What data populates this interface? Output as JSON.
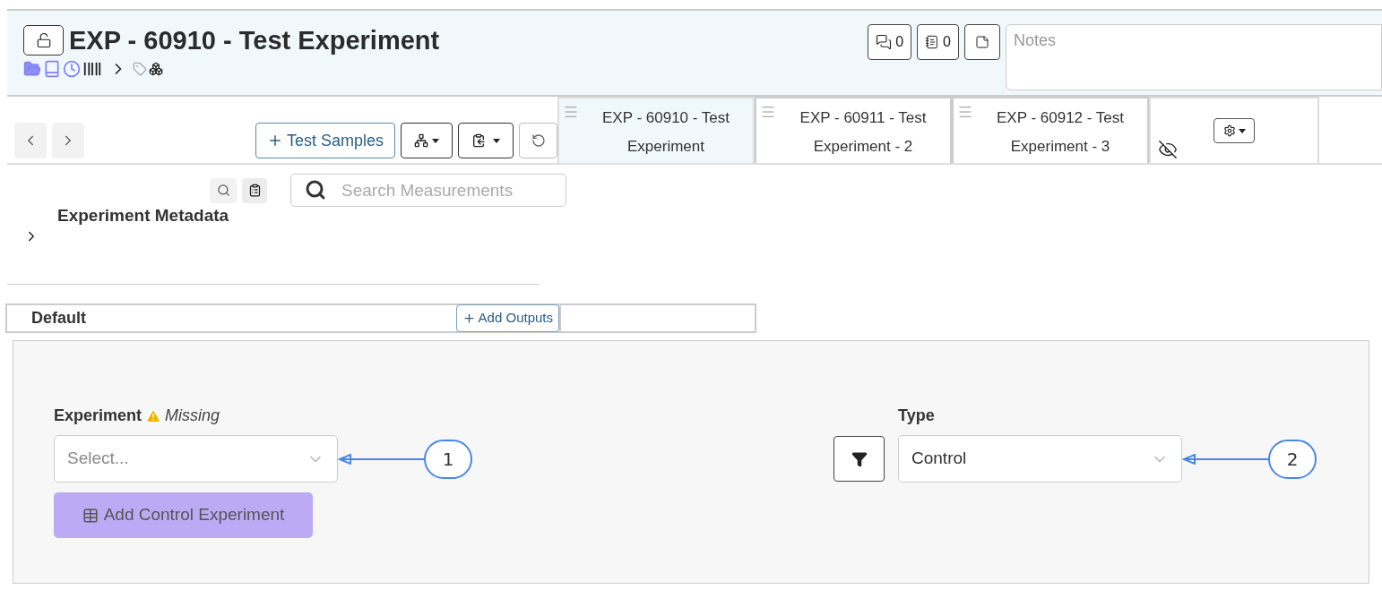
{
  "header": {
    "title": "EXP - 60910 - Test Experiment",
    "locked": false,
    "comments_count": "0",
    "notebook_count": "0",
    "notes_placeholder": "Notes"
  },
  "toolbar": {
    "add_samples": "Test Samples"
  },
  "columns": [
    {
      "line1": "EXP - 60910 - Test",
      "line2": "Experiment",
      "selected": true
    },
    {
      "line1": "EXP - 60911 - Test",
      "line2": "Experiment - 2",
      "selected": false
    },
    {
      "line1": "EXP - 60912 - Test",
      "line2": "Experiment - 3",
      "selected": false
    }
  ],
  "search": {
    "placeholder": "Search Measurements"
  },
  "metadata": {
    "title": "Experiment Metadata",
    "expanded": false
  },
  "group": {
    "name": "Default",
    "add_outputs": "Add Outputs"
  },
  "form": {
    "experiment_label": "Experiment",
    "experiment_warning": "Missing",
    "experiment_placeholder": "Select...",
    "add_button": "Add Control Experiment",
    "add_disabled": true,
    "type_label": "Type",
    "type_value": "Control"
  },
  "callouts": [
    {
      "label": "1"
    },
    {
      "label": "2"
    }
  ]
}
